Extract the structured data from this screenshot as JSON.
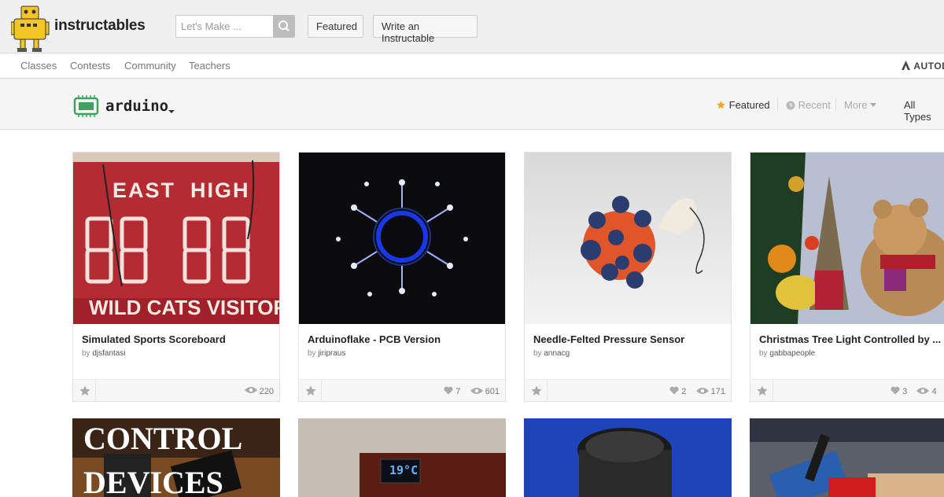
{
  "header": {
    "brand": "instructables",
    "search_placeholder": "Let's Make ...",
    "featured_label": "Featured",
    "write_label": "Write an Instructable"
  },
  "subnav": {
    "items": [
      "Classes",
      "Contests",
      "Community",
      "Teachers"
    ],
    "partner": "AUTOD"
  },
  "category": {
    "name": "arduino",
    "sort": {
      "featured": "Featured",
      "recent": "Recent",
      "more": "More",
      "types": "All Types"
    }
  },
  "cards": [
    {
      "title": "Simulated Sports Scoreboard",
      "by": "by",
      "author": "djsfantasi",
      "likes": "",
      "views": "220",
      "image_text": [
        "EAST  HIGH",
        "WILD CATS VISITOR"
      ]
    },
    {
      "title": "Arduinoflake - PCB Version",
      "by": "by",
      "author": "jiripraus",
      "likes": "7",
      "views": "601"
    },
    {
      "title": "Needle-Felted Pressure Sensor",
      "by": "by",
      "author": "annacg",
      "likes": "2",
      "views": "171"
    },
    {
      "title": "Christmas Tree Light Controlled by ...",
      "by": "by",
      "author": "gabbapeople",
      "likes": "3",
      "views": "4"
    }
  ],
  "row2": {
    "card1_text": [
      "CONTROL",
      "DEVICES"
    ],
    "card2_text": "19°C"
  },
  "colors": {
    "accent_star": "#f5a623",
    "header_bg": "#f0f0f0",
    "chip_green": "#3aa55d"
  }
}
